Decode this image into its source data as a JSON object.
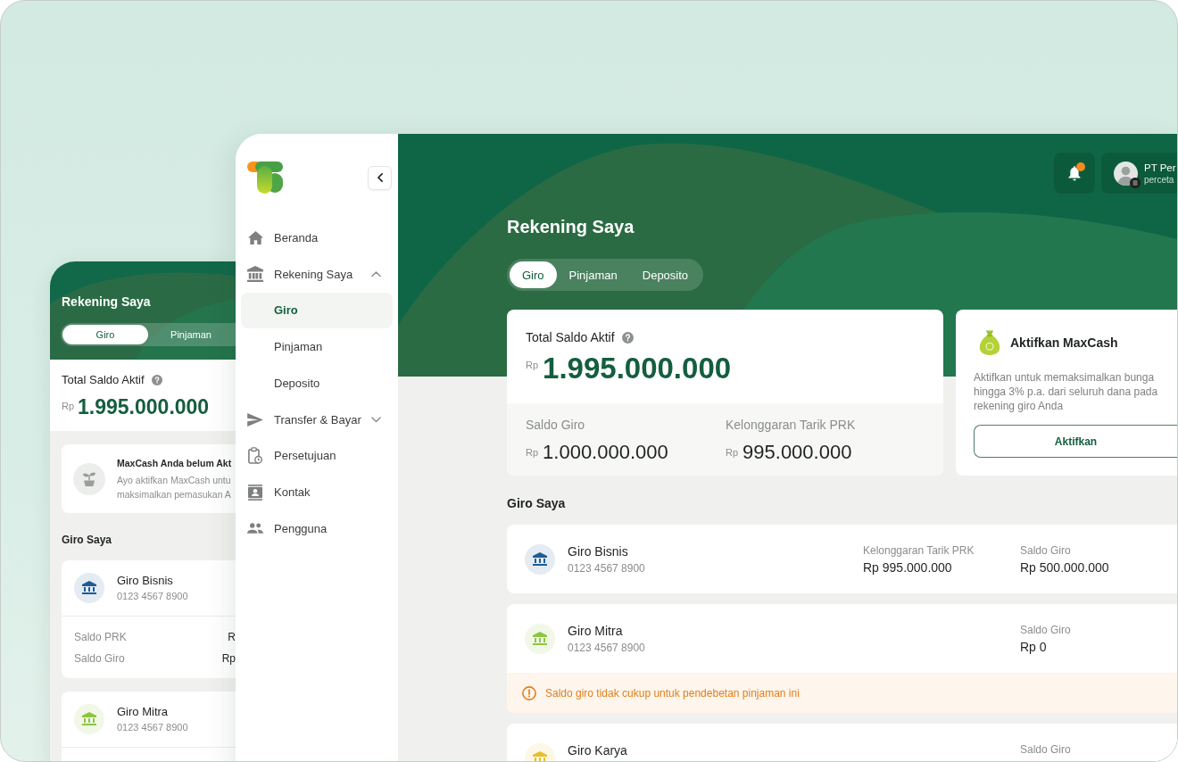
{
  "phone": {
    "title": "Rekening Saya",
    "tabs": [
      {
        "label": "Giro",
        "selected": true
      },
      {
        "label": "Pinjaman",
        "selected": false
      }
    ],
    "balance": {
      "label": "Total Saldo Aktif",
      "currency": "Rp",
      "amount": "1.995.000.000"
    },
    "promo": {
      "title": "MaxCash Anda belum Akt",
      "lines": [
        "Ayo aktifkan MaxCash untu",
        "maksimalkan pemasukan A"
      ]
    },
    "section_title": "Giro Saya",
    "accounts": [
      {
        "name": "Giro Bisnis",
        "number": "0123 4567 8900",
        "color": "#1f5b96",
        "details": [
          {
            "label": "Saldo PRK",
            "value": "R"
          },
          {
            "label": "Saldo Giro",
            "value": "Rp"
          }
        ]
      },
      {
        "name": "Giro Mitra",
        "number": "0123 4567 8900",
        "color": "#8cc63f"
      }
    ]
  },
  "sidebar": {
    "items": [
      {
        "label": "Beranda",
        "kind": "link",
        "selected": false
      },
      {
        "label": "Rekening Saya",
        "kind": "group",
        "selected": false,
        "expanded": true,
        "children": [
          {
            "label": "Giro",
            "selected": true
          },
          {
            "label": "Pinjaman",
            "selected": false
          },
          {
            "label": "Deposito",
            "selected": false
          }
        ]
      },
      {
        "label": "Transfer & Bayar",
        "kind": "group",
        "selected": false,
        "expanded": false
      },
      {
        "label": "Persetujuan",
        "kind": "link",
        "selected": false
      },
      {
        "label": "Kontak",
        "kind": "link",
        "selected": false
      },
      {
        "label": "Pengguna",
        "kind": "link",
        "selected": false
      }
    ]
  },
  "header": {
    "notifications": {
      "unread": true
    },
    "profile": {
      "name": "PT Per",
      "email": "perceta"
    }
  },
  "main": {
    "title": "Rekening Saya",
    "tabs": [
      {
        "label": "Giro",
        "selected": true
      },
      {
        "label": "Pinjaman",
        "selected": false
      },
      {
        "label": "Deposito",
        "selected": false
      }
    ],
    "balance": {
      "label": "Total Saldo Aktif",
      "currency": "Rp",
      "amount": "1.995.000.000",
      "breakdown": [
        {
          "label": "Saldo Giro",
          "currency": "Rp",
          "amount": "1.000.000.000"
        },
        {
          "label": "Kelonggaran Tarik PRK",
          "currency": "Rp",
          "amount": "995.000.000"
        }
      ]
    },
    "promo": {
      "title": "Aktifkan MaxCash",
      "text": "Aktifkan untuk memaksimalkan bunga hingga 3% p.a. dari seluruh dana pada rekening giro Anda",
      "button": "Aktifkan"
    },
    "section_title": "Giro Saya",
    "accounts": [
      {
        "name": "Giro Bisnis",
        "number": "0123 4567 8900",
        "color": "#1f5b96",
        "stats": [
          {
            "label": "Kelonggaran Tarik PRK",
            "value": "Rp 995.000.000"
          },
          {
            "label": "Saldo Giro",
            "value": "Rp 500.000.000"
          }
        ]
      },
      {
        "name": "Giro Mitra",
        "number": "0123 4567 8900",
        "color": "#8cc63f",
        "stats": [
          {
            "label": "Saldo Giro",
            "value": "Rp 0"
          }
        ],
        "warning": "Saldo giro tidak cukup untuk pendebetan pinjaman ini"
      },
      {
        "name": "Giro Karya",
        "color": "#e6bf2e",
        "stats": [
          {
            "label": "Saldo Giro"
          }
        ]
      }
    ]
  }
}
